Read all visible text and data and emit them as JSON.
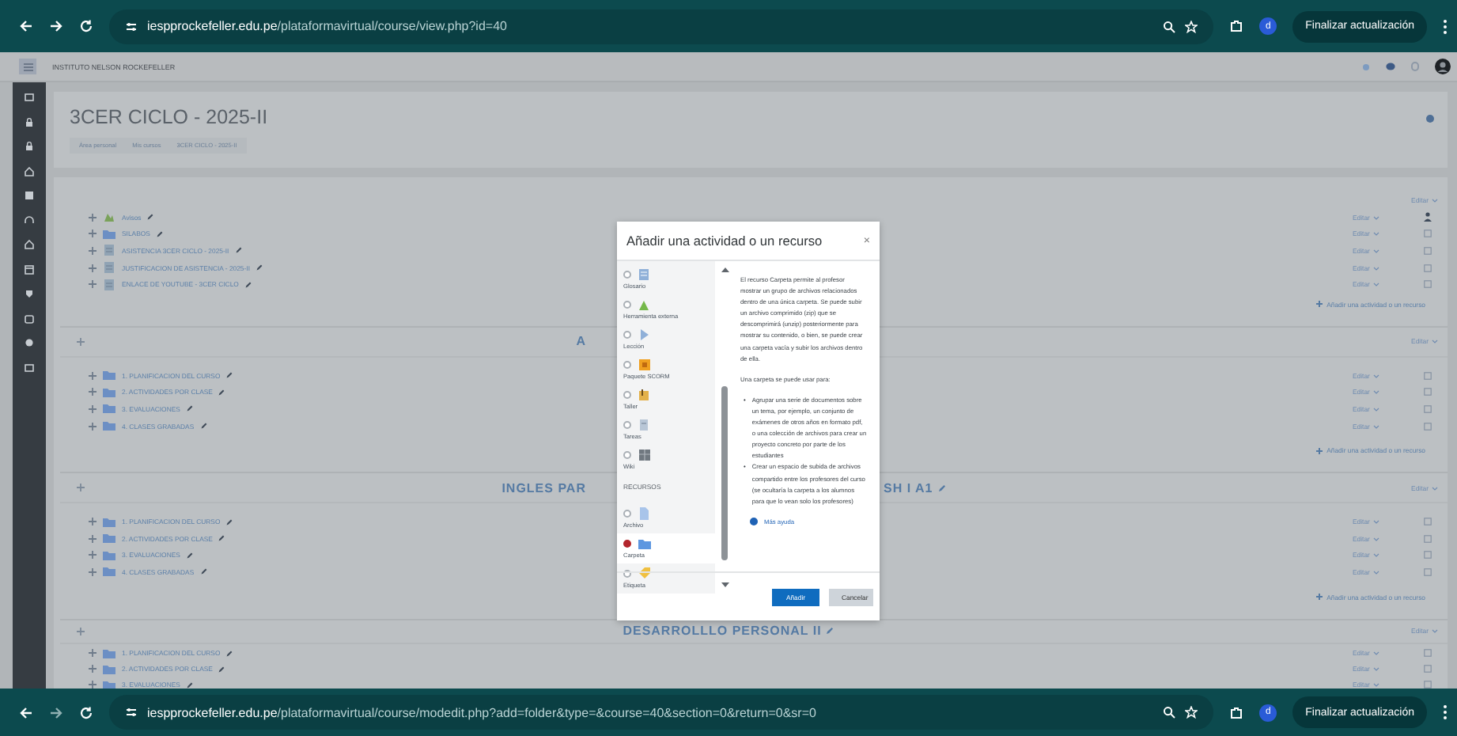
{
  "browser_top": {
    "url_domain": "iespprockefeller.edu.pe",
    "url_path": "/plataformavirtual/course/view.php?id=40",
    "profile_initial": "d",
    "update_button": "Finalizar actualización"
  },
  "site_header": {
    "name": "INSTITUTO NELSON ROCKEFELLER"
  },
  "course": {
    "title": "3CER CICLO - 2025-II",
    "breadcrumbs": [
      "Área personal",
      "Mis cursos",
      "3CER CICLO - 2025-II"
    ]
  },
  "sections": [
    {
      "edit_label": "Editar",
      "items": [
        {
          "name": "Avisos",
          "kind": "forum",
          "edit_label": "Editar"
        },
        {
          "name": "SILABOS",
          "kind": "folder",
          "edit_label": "Editar"
        },
        {
          "name": "ASISTENCIA 3CER CICLO - 2025-II",
          "kind": "page",
          "edit_label": "Editar"
        },
        {
          "name": "JUSTIFICACION DE ASISTENCIA - 2025-II",
          "kind": "page",
          "edit_label": "Editar"
        },
        {
          "name": "ENLACE DE YOUTUBE - 3CER CICLO",
          "kind": "page",
          "edit_label": "Editar"
        }
      ],
      "add_link": "Añadir una actividad o un recurso"
    },
    {
      "title_parts": [
        "A"
      ],
      "edit_label": "Editar",
      "items": [
        {
          "name": "1. PLANIFICACION DEL CURSO",
          "kind": "folder",
          "edit_label": "Editar"
        },
        {
          "name": "2. ACTIVIDADES POR CLASE",
          "kind": "folder",
          "edit_label": "Editar"
        },
        {
          "name": "3. EVALUACIONES",
          "kind": "folder",
          "edit_label": "Editar"
        },
        {
          "name": "4. CLASES GRABADAS",
          "kind": "folder",
          "edit_label": "Editar"
        }
      ],
      "add_link": "Añadir una actividad o un recurso"
    },
    {
      "title_parts": [
        "INGLES PAR",
        "SH I A1"
      ],
      "edit_label": "Editar",
      "items": [
        {
          "name": "1. PLANIFICACION DEL CURSO",
          "kind": "folder",
          "edit_label": "Editar"
        },
        {
          "name": "2. ACTIVIDADES POR CLASE",
          "kind": "folder",
          "edit_label": "Editar"
        },
        {
          "name": "3. EVALUACIONES",
          "kind": "folder",
          "edit_label": "Editar"
        },
        {
          "name": "4. CLASES GRABADAS",
          "kind": "folder",
          "edit_label": "Editar"
        }
      ],
      "add_link": "Añadir una actividad o un recurso"
    },
    {
      "title_parts": [
        "DESARROLLLO PERSONAL II"
      ],
      "edit_label": "Editar",
      "items": [
        {
          "name": "1. PLANIFICACION DEL CURSO",
          "kind": "folder",
          "edit_label": "Editar"
        },
        {
          "name": "2. ACTIVIDADES POR CLASE",
          "kind": "folder",
          "edit_label": "Editar"
        },
        {
          "name": "3. EVALUACIONES",
          "kind": "folder",
          "edit_label": "Editar"
        }
      ]
    }
  ],
  "chooser": {
    "title": "Añadir una actividad o un recurso",
    "close": "×",
    "options": [
      {
        "kind": "module",
        "label": "Glosario",
        "selected": false
      },
      {
        "kind": "module",
        "label": "Herramienta externa",
        "selected": false
      },
      {
        "kind": "module",
        "label": "Lección",
        "selected": false
      },
      {
        "kind": "module",
        "label": "Paquete SCORM",
        "selected": false
      },
      {
        "kind": "module",
        "label": "Taller",
        "selected": false
      },
      {
        "kind": "module",
        "label": "Tareas",
        "selected": false
      },
      {
        "kind": "module",
        "label": "Wiki",
        "selected": false
      },
      {
        "kind": "heading",
        "label": "RECURSOS"
      },
      {
        "kind": "module",
        "label": "Archivo",
        "selected": false
      },
      {
        "kind": "module",
        "label": "Carpeta",
        "selected": true
      },
      {
        "kind": "module",
        "label": "Etiqueta",
        "selected": false
      }
    ],
    "description": {
      "intro": "El recurso Carpeta permite al profesor mostrar un grupo de archivos relacionados dentro de una única carpeta. Se puede subir un archivo comprimido (zip) que se descomprimirá (unzip) posteriormente para mostrar su contenido, o bien, se puede crear una carpeta vacía y subir los archivos dentro de ella.",
      "uses_heading": "Una carpeta se puede usar para:",
      "bullets": [
        {
          "marker": "•",
          "text": "Agrupar una serie de documentos sobre un tema, por ejemplo, un conjunto de exámenes de otros años en formato pdf, o una colección de archivos para crear un proyecto concreto por parte de los estudiantes"
        },
        {
          "marker": "•",
          "text": "Crear un espacio de subida de archivos compartido entre los profesores del curso (se ocultaría la carpeta a los alumnos para que lo vean solo los profesores)"
        }
      ],
      "help_link": "Más ayuda"
    },
    "buttons": [
      "Añadir",
      "Cancelar"
    ]
  },
  "browser_bottom": {
    "url_domain": "iespprockefeller.edu.pe",
    "url_path": "/plataformavirtual/course/modedit.php?add=folder&type=&course=40&section=0&return=0&sr=0",
    "profile_initial": "d",
    "update_button": "Finalizar actualización"
  }
}
